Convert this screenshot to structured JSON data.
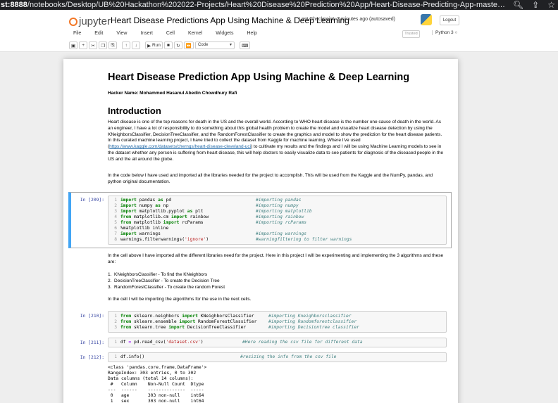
{
  "browser": {
    "url_host": "st:8888",
    "url_path": "/notebooks/Desktop/UB%20Hackathon%202022-Projects/Heart%20Disease%20Prediction%20App/Heart-Disease-Predicting-App-master/Heart%20..."
  },
  "jupyter": {
    "logo_text": "jupyter",
    "notebook_title": "Heart Disease Predictions App Using Machine & Deep Learning",
    "checkpoint": "Last Checkpoint: 3 minutes ago",
    "autosave": "(autosaved)",
    "logout_label": "Logout",
    "trusted_label": "Trusted",
    "kernel_label": "Python 3",
    "menu": [
      "File",
      "Edit",
      "View",
      "Insert",
      "Cell",
      "Kernel",
      "Widgets",
      "Help"
    ],
    "run_label": "Run",
    "cell_type": "Code"
  },
  "notebook": {
    "title": "Heart Disease Prediction App Using Machine & Deep Learning",
    "author": "Hacker Name: Mohammed Hasanul Abedin Chowdhury Rafi",
    "intro_heading": "Introduction",
    "intro_p1_a": "Heart disease is one of the top reasons for death in the US and the overall world. According to WHO heart disease is the number one cause of death in the world. As an engineer, I have a lot of responsibility to do something about this global health problem to create the model and visualize heart disease detection by using the KNeighborsClassifier, DecisionTreeClassifier, and the RandomForestClassifier to create the graphics and model to show the prediction for the heart disease patients. In this curated machine learning project, I have tried to collect the dataset from Kaggle for machine learning, Where I've used (",
    "intro_p1_link": "https://www.kaggle.com/datasets/cherngs/heart-disease-cleveland-uci",
    "intro_p1_b": ") to cultivate my results and the findings and I will be using Machine Learning models to see in the dataset whether any person is suffering from heart disease, this will help doctors to easily visualize data to see patients for diagnosis of the diseased people in the US and the all around the globe.",
    "intro_p2": "In the code below I have used and imported all the libraries needed for the project to accomplish. This will be used from the Kaggle and the NumPy, pandas, and python original documentation.",
    "after_cell_p": "In the cell above I have imported all the different libraries need for the project. Here in this project I will be experimenting and implementing the 3 algorithms and these are:",
    "list": [
      "KNeighborsClassifier - To find the KNeighbors",
      "DecisionTreeClassifier - To create the Decision Tree",
      "RandomForestClassifier - To create the random Forest"
    ],
    "import_p": "In the cell I will be importing the algorithms for the use in the next cells.",
    "prompts": [
      "In [209]:",
      "In [210]:",
      "In [211]:",
      "In [212]:"
    ],
    "cell209": [
      {
        "n": "1",
        "parts": [
          [
            "kw",
            "import"
          ],
          [
            "t",
            " pandas "
          ],
          [
            "kw",
            "as"
          ],
          [
            "t",
            " pd"
          ]
        ],
        "comment": "#importing pandas"
      },
      {
        "n": "2",
        "parts": [
          [
            "kw",
            "import"
          ],
          [
            "t",
            " numpy "
          ],
          [
            "kw",
            "as"
          ],
          [
            "t",
            " np"
          ]
        ],
        "comment": "#importing numpy"
      },
      {
        "n": "3",
        "parts": [
          [
            "kw",
            "import"
          ],
          [
            "t",
            " matplotlib.pyplot "
          ],
          [
            "kw",
            "as"
          ],
          [
            "t",
            " plt"
          ]
        ],
        "comment": "#importing matplotlib"
      },
      {
        "n": "4",
        "parts": [
          [
            "kw",
            "from"
          ],
          [
            "t",
            " matplotlib.cm "
          ],
          [
            "kw",
            "import"
          ],
          [
            "t",
            " rainbow"
          ]
        ],
        "comment": "#importing rainbow"
      },
      {
        "n": "5",
        "parts": [
          [
            "kw",
            "from"
          ],
          [
            "t",
            " matplotlib "
          ],
          [
            "kw",
            "import"
          ],
          [
            "t",
            " rcParams"
          ]
        ],
        "comment": "#importing rcParams"
      },
      {
        "n": "6",
        "parts": [
          [
            "t",
            "%matplotlib inline"
          ]
        ],
        "comment": ""
      },
      {
        "n": "7",
        "parts": [
          [
            "kw",
            "import"
          ],
          [
            "t",
            " warnings"
          ]
        ],
        "comment": "#importing warnings"
      },
      {
        "n": "8",
        "parts": [
          [
            "t",
            "warnings.filterwarnings("
          ],
          [
            "st",
            "'ignore'"
          ],
          [
            "t",
            ")"
          ]
        ],
        "comment": "#warningfiltering to filter warnings"
      }
    ],
    "cell210": [
      {
        "n": "1",
        "parts": [
          [
            "kw",
            "from"
          ],
          [
            "t",
            " sklearn.neighbors "
          ],
          [
            "kw",
            "import"
          ],
          [
            "t",
            " KNeighborsClassifier"
          ]
        ],
        "comment": "#importing Kneighborsclassifier"
      },
      {
        "n": "2",
        "parts": [
          [
            "kw",
            "from"
          ],
          [
            "t",
            " sklearn.ensemble "
          ],
          [
            "kw",
            "import"
          ],
          [
            "t",
            " RandomForestClassifier"
          ]
        ],
        "comment": "#importing Randomforestclassifier"
      },
      {
        "n": "3",
        "parts": [
          [
            "kw",
            "from"
          ],
          [
            "t",
            " sklearn.tree "
          ],
          [
            "kw",
            "import"
          ],
          [
            "t",
            " DecisionTreeClassifier"
          ]
        ],
        "comment": "#importing Decisiontree classifier"
      }
    ],
    "cell211": [
      {
        "n": "1",
        "parts": [
          [
            "t",
            "df "
          ],
          [
            "op",
            "="
          ],
          [
            "t",
            " pd.read_csv("
          ],
          [
            "st",
            "'dataset.csv'"
          ],
          [
            "t",
            ")"
          ]
        ],
        "comment": "#Here reading the csv file for different data"
      }
    ],
    "cell212": [
      {
        "n": "1",
        "parts": [
          [
            "t",
            "df.info()"
          ]
        ],
        "comment": "#resizing the info from the csv file"
      }
    ],
    "output212": [
      "<class 'pandas.core.frame.DataFrame'>",
      "RangeIndex: 303 entries, 0 to 302",
      "Data columns (total 14 columns):",
      " #   Column    Non-Null Count  Dtype",
      "---  ------    --------------  -----",
      " 0   age       303 non-null    int64",
      " 1   sex       303 non-null    int64"
    ]
  }
}
